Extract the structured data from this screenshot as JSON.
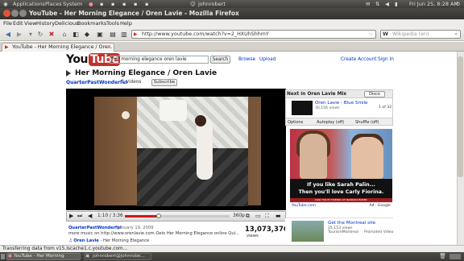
{
  "system_panel": {
    "menus": [
      "Applications",
      "Places",
      "System"
    ],
    "user": "johnrobert",
    "datetime": "Fri Jun 25,  8:28 AM"
  },
  "window": {
    "title": "YouTube - Her Morning Elegance / Oren Lavie - Mozilla Firefox"
  },
  "menubar": [
    "File",
    "Edit",
    "View",
    "History",
    "Delicious",
    "Bookmarks",
    "Tools",
    "Help"
  ],
  "navbar": {
    "url": "http://www.youtube.com/watch?v=2_HXUhShhmY",
    "search_placeholder": "Wikipedia (en)"
  },
  "tabs": [
    {
      "label": "YouTube - Her Morning Elegance / Ore..."
    }
  ],
  "youtube": {
    "logo_you": "You",
    "logo_tube": "Tube",
    "search_value": "her morning elegance oren lavie",
    "search_button": "Search",
    "links": {
      "browse": "Browse",
      "upload": "Upload",
      "create_account": "Create Account",
      "sign_in": "Sign In"
    },
    "video_title": "Her Morning Elegance / Oren Lavie",
    "channel": "QuarterPastWonderful",
    "video_count": "1 videos",
    "subscribe": "Subscribe",
    "player": {
      "time": "1:10 / 3:36",
      "quality": "360p",
      "progress_fraction": 0.32
    },
    "uploader": "QuarterPastWonderful",
    "upload_date": "January 19, 2009",
    "description": "more music on http://www.orenlavie.com Oelo Her Morning Elegance online Qui...",
    "views": "13,073,376",
    "views_label": "views",
    "song_artist": "Oren Lavie",
    "song_sep": " - ",
    "song_title": "Her Morning Elegance",
    "mix": {
      "header": "Next in Oren Lavie Mix",
      "disco_button": "Disco",
      "item_title": "Oren Lavie - Blue Smile",
      "item_views": "30,156 views",
      "item_count": "1 of 32",
      "options": "Options",
      "autoplay": "Autoplay (off)",
      "shuffle": "Shuffle (off)"
    },
    "ad": {
      "line1": "If you like Sarah Palin...",
      "line2": "Then you'll love Carly Fiorina.",
      "strip": "PAID FOR BY FRIENDS OF BARBARA BOXER",
      "foot_left": "YouTube.com",
      "foot_right": "Ad · Google"
    },
    "promoted": {
      "title": "Get the Montreal site",
      "views": "25,153 views",
      "owner": "TourismMontreal",
      "label": "Promoted Video"
    }
  },
  "status_text": "Transferring data from v15.lscache1.c.youtube.com...",
  "taskbar": {
    "task1": "YouTube - Her Morning",
    "task2": "johnrobert@johnrobe..."
  },
  "colors": {
    "youtube_red": "#c4302b",
    "link_blue": "#0033cc",
    "progress_red": "#cc181e"
  }
}
